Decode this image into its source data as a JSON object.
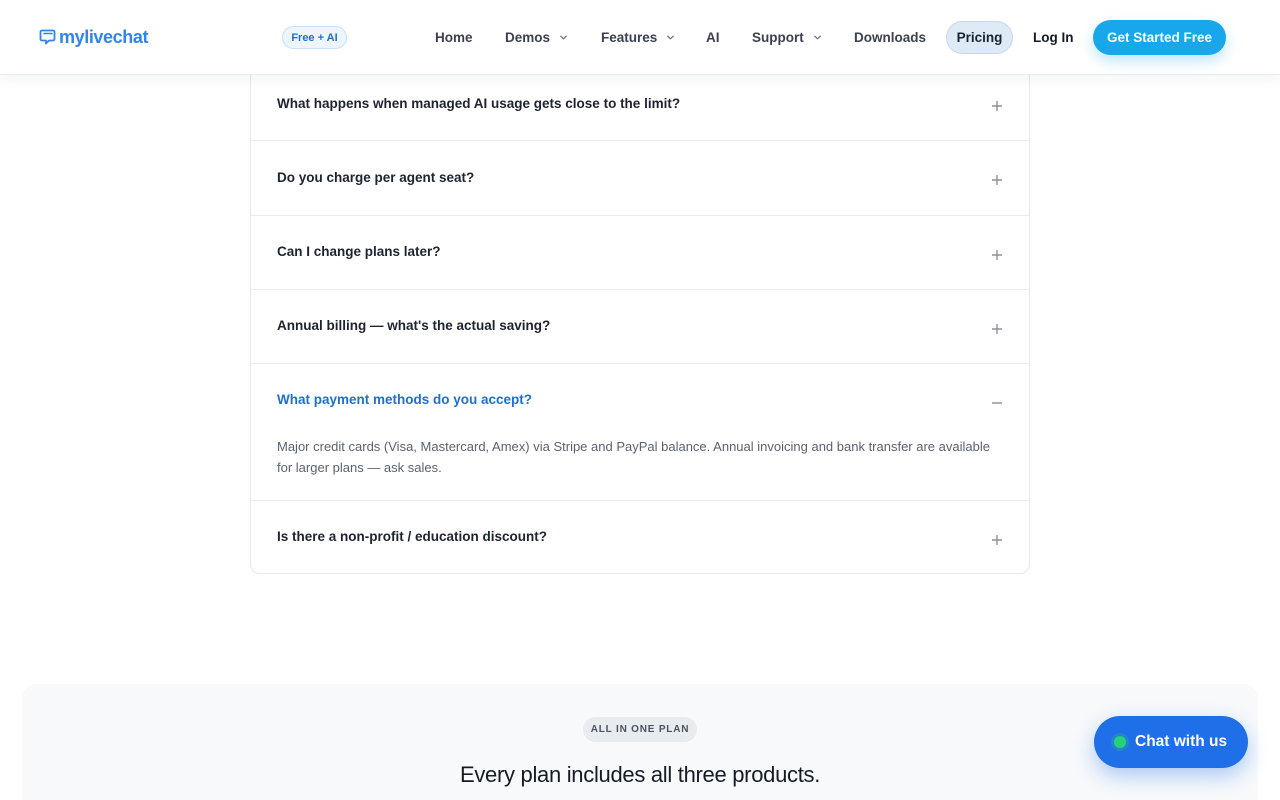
{
  "header": {
    "logo_text": "mylivechat",
    "badge": "Free + AI",
    "nav": [
      {
        "label": "Home",
        "has_dropdown": false
      },
      {
        "label": "Demos",
        "has_dropdown": true
      },
      {
        "label": "Features",
        "has_dropdown": true
      },
      {
        "label": "AI",
        "has_dropdown": false
      },
      {
        "label": "Support",
        "has_dropdown": true
      },
      {
        "label": "Downloads",
        "has_dropdown": false
      }
    ],
    "active_nav": "Pricing",
    "login": "Log In",
    "cta": "Get Started Free"
  },
  "faq": {
    "items": [
      {
        "question": "What happens when managed AI usage gets close to the limit?",
        "open": false
      },
      {
        "question": "Do you charge per agent seat?",
        "open": false
      },
      {
        "question": "Can I change plans later?",
        "open": false
      },
      {
        "question": "Annual billing — what's the actual saving?",
        "open": false
      },
      {
        "question": "What payment methods do you accept?",
        "open": true,
        "answer": "Major credit cards (Visa, Mastercard, Amex) via Stripe and PayPal balance. Annual invoicing and bank transfer are available for larger plans — ask sales."
      },
      {
        "question": "Is there a non-profit / education discount?",
        "open": false
      }
    ]
  },
  "section": {
    "eyebrow": "ALL IN ONE PLAN",
    "title": "Every plan includes all three products."
  },
  "chat_widget": {
    "label": "Chat with us"
  },
  "colors": {
    "brand_blue": "#2f86ea",
    "cta_blue": "#19a7ec",
    "chat_blue": "#1f6fe8",
    "online_green": "#27d07a",
    "open_question": "#1f6fd1"
  },
  "icons": {
    "logo": "chat-bubbles-icon",
    "dropdown": "chevron-down-icon",
    "expand": "plus-icon",
    "collapse": "minus-icon",
    "chat_status": "online-dot-icon"
  }
}
